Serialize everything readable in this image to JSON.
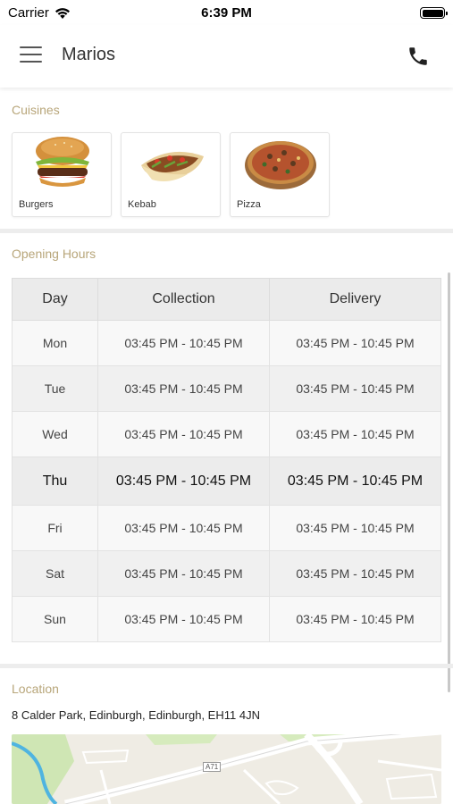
{
  "status_bar": {
    "carrier": "Carrier",
    "time": "6:39 PM"
  },
  "header": {
    "title": "Marios",
    "menu_icon": "hamburger-menu-icon",
    "phone_icon": "phone-icon"
  },
  "cuisines": {
    "label": "Cuisines",
    "items": [
      {
        "name": "Burgers",
        "icon": "burger-image"
      },
      {
        "name": "Kebab",
        "icon": "kebab-image"
      },
      {
        "name": "Pizza",
        "icon": "pizza-image"
      }
    ]
  },
  "opening_hours": {
    "label": "Opening Hours",
    "columns": [
      "Day",
      "Collection",
      "Delivery"
    ],
    "rows": [
      {
        "day": "Mon",
        "collection": "03:45 PM - 10:45 PM",
        "delivery": "03:45 PM - 10:45 PM"
      },
      {
        "day": "Tue",
        "collection": "03:45 PM - 10:45 PM",
        "delivery": "03:45 PM - 10:45 PM"
      },
      {
        "day": "Wed",
        "collection": "03:45 PM - 10:45 PM",
        "delivery": "03:45 PM - 10:45 PM"
      },
      {
        "day": "Thu",
        "collection": "03:45 PM - 10:45 PM",
        "delivery": "03:45 PM - 10:45 PM"
      },
      {
        "day": "Fri",
        "collection": "03:45 PM - 10:45 PM",
        "delivery": "03:45 PM - 10:45 PM"
      },
      {
        "day": "Sat",
        "collection": "03:45 PM - 10:45 PM",
        "delivery": "03:45 PM - 10:45 PM"
      },
      {
        "day": "Sun",
        "collection": "03:45 PM - 10:45 PM",
        "delivery": "03:45 PM - 10:45 PM"
      }
    ],
    "highlighted_day": "Thu"
  },
  "location": {
    "label": "Location",
    "address": "8 Calder Park, Edinburgh, Edinburgh, EH11 4JN",
    "map_road_label": "A71"
  },
  "colors": {
    "section_label": "#b8a67a",
    "table_header_bg": "#ebebeb"
  }
}
